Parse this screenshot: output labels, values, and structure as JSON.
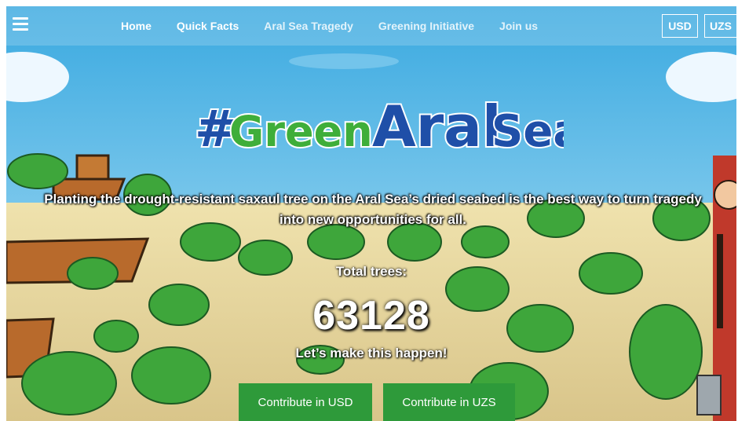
{
  "nav": {
    "menu_icon": "hamburger-menu-icon",
    "items": [
      {
        "label": "Home"
      },
      {
        "label": "Quick Facts"
      },
      {
        "label": "Aral Sea Tragedy"
      },
      {
        "label": "Greening Initiative"
      },
      {
        "label": "Join us"
      }
    ],
    "currencies": [
      "USD",
      "UZS"
    ]
  },
  "hero": {
    "logo_text": "#GreenAralSea",
    "tagline_line1": "Planting the drought-resistant saxaul tree on the Aral Sea’s dried seabed is the best way to turn tragedy",
    "tagline_line2": "into new opportunities for all.",
    "total_label": "Total trees:",
    "total_count": "63128",
    "cta_line": "Let’s make this happen!",
    "buttons": {
      "usd": "Contribute in USD",
      "uzs": "Contribute in UZS"
    }
  },
  "colors": {
    "sky": "#4fb6e6",
    "sand": "#e8d9a0",
    "tree": "#3ea63b",
    "button": "#2e9a3a",
    "logo_blue": "#1f4fa8",
    "logo_green": "#3fae3a"
  }
}
